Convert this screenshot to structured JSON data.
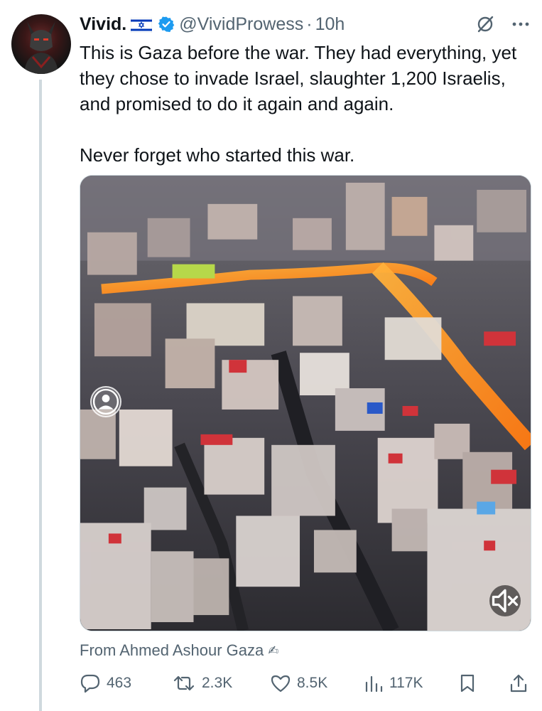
{
  "author": {
    "display_name": "Vivid.",
    "handle": "@VividProwess",
    "separator": "·",
    "time": "10h",
    "flag_icon": "israel-flag-icon",
    "verified_icon": "verified-badge-icon",
    "verified_color": "#1d9bf0"
  },
  "tweet": {
    "paragraph_1": "This is Gaza before the war. They had everything, yet they chose to invade Israel, slaughter 1,200 Israelis, and promised to do it again and again.",
    "paragraph_2": "Never forget who started this war."
  },
  "media": {
    "type": "video",
    "mute_icon": "muted-speaker-icon",
    "badge_icon": "globe-icon"
  },
  "source": {
    "text": "From Ahmed Ashour Gaza",
    "trailing_glyph": "✍"
  },
  "actions": {
    "replies": "463",
    "reposts": "2.3K",
    "likes": "8.5K",
    "views": "117K"
  },
  "colors": {
    "text_primary": "#0f1419",
    "text_secondary": "#536471",
    "accent": "#1d9bf0",
    "thread_line": "#cfd9de"
  }
}
